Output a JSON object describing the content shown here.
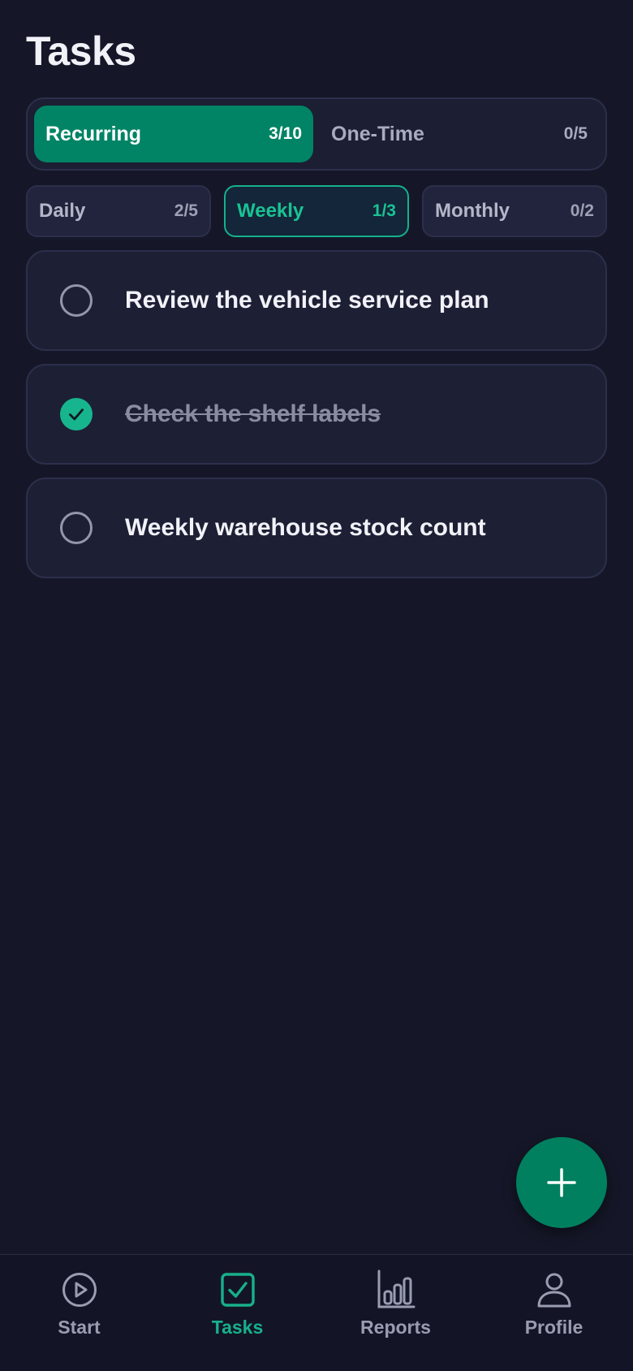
{
  "header": {
    "title": "Tasks"
  },
  "segments": [
    {
      "label": "Recurring",
      "count": "3/10",
      "active": true
    },
    {
      "label": "One-Time",
      "count": "0/5",
      "active": false
    }
  ],
  "periods": [
    {
      "label": "Daily",
      "count": "2/5",
      "active": false
    },
    {
      "label": "Weekly",
      "count": "1/3",
      "active": true
    },
    {
      "label": "Monthly",
      "count": "0/2",
      "active": false
    }
  ],
  "tasks": [
    {
      "title": "Review the vehicle service plan",
      "done": false
    },
    {
      "title": "Check the shelf labels",
      "done": true
    },
    {
      "title": "Weekly warehouse stock count",
      "done": false
    }
  ],
  "fab": {
    "icon": "plus-icon"
  },
  "nav": [
    {
      "label": "Start",
      "icon": "play-circle-icon",
      "active": false
    },
    {
      "label": "Tasks",
      "icon": "checkbox-icon",
      "active": true
    },
    {
      "label": "Reports",
      "icon": "bar-chart-icon",
      "active": false
    },
    {
      "label": "Profile",
      "icon": "user-icon",
      "active": false
    }
  ],
  "colors": {
    "background": "#151728",
    "accent": "#008465",
    "accent_text": "#17B08C",
    "card": "#1D1F35",
    "muted_text": "#9A9CB1"
  }
}
